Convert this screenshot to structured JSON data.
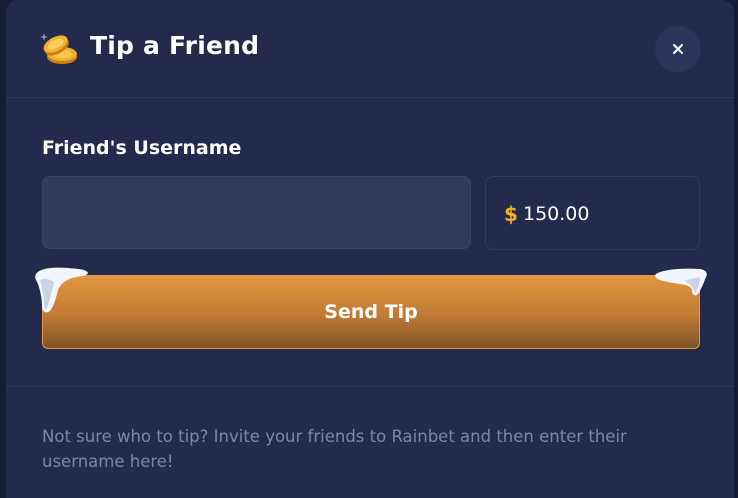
{
  "modal": {
    "title": "Tip a Friend",
    "icon": "coins-icon",
    "close_label": "×"
  },
  "form": {
    "username_label": "Friend's Username",
    "username_value": "",
    "username_placeholder": "",
    "currency_symbol": "$",
    "amount_value": "150.00",
    "send_label": "Send Tip"
  },
  "footer": {
    "info_text": "Not sure who to tip? Invite your friends to Rainbet and then enter their username here!"
  },
  "colors": {
    "modal_bg": "#232a4b",
    "input_bg": "#323a5c",
    "accent_orange": "#e3963f",
    "currency_gold": "#f5b321",
    "muted_text": "#7f86a3"
  }
}
